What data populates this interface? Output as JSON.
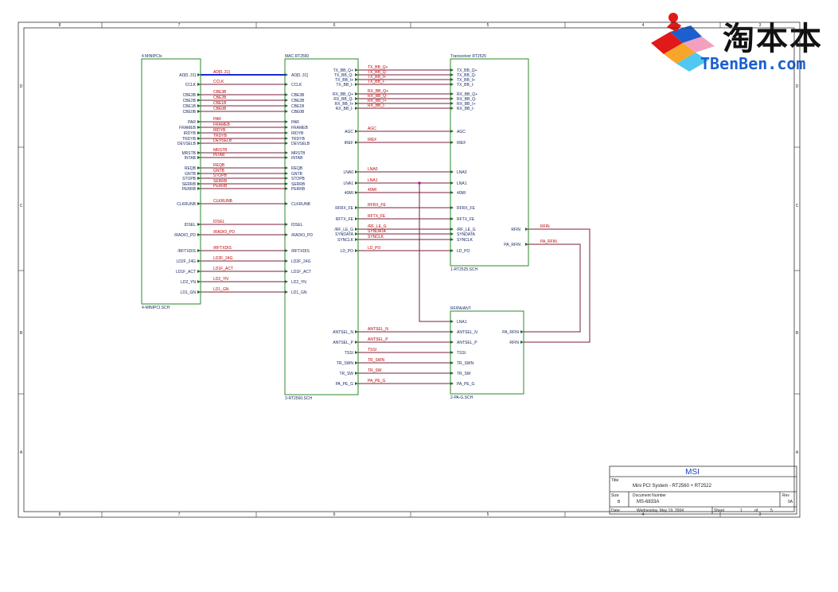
{
  "logo": {
    "cn": "淘本本",
    "en": "TBenBen.com",
    "colors": {
      "red": "#e11919",
      "blue": "#1b5fd1",
      "pink": "#f2a0c0",
      "orange": "#f7a629",
      "cyan": "#50c8f0"
    }
  },
  "colors": {
    "block": "#2a8a2a",
    "wire": "#7a1f3a",
    "bus": "#1a2ad0",
    "net_label": "#c00000",
    "pin_label": "#1a2a66"
  },
  "frame": {
    "cols": [
      "8",
      "7",
      "6",
      "5",
      "4",
      "3",
      "2",
      "1"
    ],
    "rows": [
      "D",
      "C",
      "B",
      "A"
    ]
  },
  "blocks": {
    "minipci": {
      "title": "4 MINIPCIs",
      "footer": "4-MINIPCI.SCH"
    },
    "mac": {
      "title": "MAC RT2560",
      "footer": "3-RT2560.SCH"
    },
    "transceiver": {
      "title": "Transceiver RT2525",
      "footer": "1-RT2525.SCH"
    },
    "pa": {
      "title": "RF/PA/ANT",
      "footer": "2-PA-G.SCH"
    }
  },
  "left_group": [
    {
      "pin": "AD[0..31]",
      "net": "AD[0..31]",
      "bus": true
    },
    {
      "pin": "CCLK",
      "net": "CCLK"
    },
    {
      "pin": "CBE3B",
      "net": "CBE3B"
    },
    {
      "pin": "CBE2B",
      "net": "CBE2B"
    },
    {
      "pin": "CBE1B",
      "net": "CBE1B"
    },
    {
      "pin": "CBE0B",
      "net": "CBE0B"
    },
    {
      "pin": "PAR",
      "net": "PAR"
    },
    {
      "pin": "FRAMEB",
      "net": "FRAMEB"
    },
    {
      "pin": "IRDYB",
      "net": "IRDYB"
    },
    {
      "pin": "TRDYB",
      "net": "TRDYB"
    },
    {
      "pin": "DEVSELB",
      "net": "DEVSELB"
    },
    {
      "pin": "MRSTB",
      "net": "MRSTB"
    },
    {
      "pin": "INTAB",
      "net": "INTAB"
    },
    {
      "pin": "REQB",
      "net": "REQB"
    },
    {
      "pin": "GNTB",
      "net": "GNTB"
    },
    {
      "pin": "STOPB",
      "net": "STOPB"
    },
    {
      "pin": "SERRB",
      "net": "SERRB"
    },
    {
      "pin": "PERRB",
      "net": "PERRB"
    },
    {
      "pin": "CLKRUNB",
      "net": "CLKRUNB"
    },
    {
      "pin": "IDSEL",
      "net": "IDSEL"
    },
    {
      "pin": "/RADIO_PD",
      "net": "/RADIO_PD"
    },
    {
      "pin": "/RFTXDIS",
      "net": "/RFTXDIS"
    },
    {
      "pin": "LD2F_24G",
      "net": "LD2F_24G"
    },
    {
      "pin": "LD1F_ACT",
      "net": "LD1F_ACT"
    },
    {
      "pin": "LD2_YN",
      "net": "LD2_YN"
    },
    {
      "pin": "LD1_GN",
      "net": "LD1_GN"
    }
  ],
  "mid_group": [
    {
      "pin": "TX_BB_Q+",
      "net": "TX_BB_Q+"
    },
    {
      "pin": "TX_BB_Q-",
      "net": "TX_BB_Q-"
    },
    {
      "pin": "TX_BB_I+",
      "net": "TX_BB_I+"
    },
    {
      "pin": "TX_BB_I-",
      "net": "TX_BB_I-"
    },
    {
      "pin": "RX_BB_Q+",
      "net": "RX_BB_Q+"
    },
    {
      "pin": "RX_BB_Q-",
      "net": "RX_BB_Q-"
    },
    {
      "pin": "RX_BB_I+",
      "net": "RX_BB_I+"
    },
    {
      "pin": "RX_BB_I-",
      "net": "RX_BB_I-"
    },
    {
      "pin": "AGC",
      "net": "AGC"
    },
    {
      "pin": "IREF",
      "net": "IREF"
    },
    {
      "pin": "LNA0",
      "net": "LNA0"
    },
    {
      "pin": "LNA1",
      "net": "LNA1"
    },
    {
      "pin": "40MI",
      "net": "40MI"
    },
    {
      "pin": "RFRX_FE",
      "net": "RFRX_FE"
    },
    {
      "pin": "RFTX_FE",
      "net": "RFTX_FE"
    },
    {
      "pin": "/RF_LE_G",
      "net": "/RF_LE_G"
    },
    {
      "pin": "SYNDATA",
      "net": "SYNDATA"
    },
    {
      "pin": "SYNCLK",
      "net": "SYNCLK"
    },
    {
      "pin": "LD_PO",
      "net": "LD_PO"
    }
  ],
  "pa_group": [
    {
      "pin": "ANTSEL_N",
      "net": "ANTSEL_N"
    },
    {
      "pin": "ANTSEL_P",
      "net": "ANTSEL_P"
    },
    {
      "pin": "TSSI",
      "net": "TSSI"
    },
    {
      "pin": "TR_SWN",
      "net": "TR_SWN"
    },
    {
      "pin": "TR_SW",
      "net": "TR_SW"
    },
    {
      "pin": "PA_PE_G",
      "net": "PA_PE_G"
    }
  ],
  "rf_links": {
    "trx_rfin": "RFIN",
    "trx_pa_rfin": "PA_RFIN",
    "net_rfin": "RFIN",
    "net_pa_rfin": "PA_RFIN",
    "pa_lna1": "LNA1",
    "pa_pa_rfin": "PA_RFIN",
    "pa_rfin": "RFIN"
  },
  "title_block": {
    "company": "MSI",
    "title_label": "Title",
    "title": "Mini PCI System - RT2560 + RT2522",
    "size_label": "Size",
    "size": "B",
    "docnum_label": "Document Number",
    "docnum": "MS-6833A",
    "rev_label": "Rev",
    "rev": "0A",
    "date_label": "Date:",
    "date": "Wednesday, May 19, 2004",
    "sheet_label": "Sheet",
    "sheet": "1",
    "of_label": "of",
    "of": "5"
  }
}
